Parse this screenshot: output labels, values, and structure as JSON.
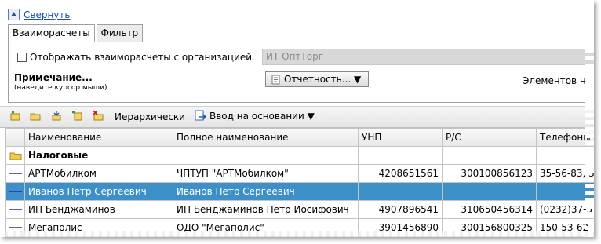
{
  "header": {
    "collapse_label": "Свернуть"
  },
  "tabs": [
    {
      "label": "Взаиморасчеты",
      "active": true
    },
    {
      "label": "Фильтр",
      "active": false
    }
  ],
  "settlements": {
    "show_label": "Отображать взаиморасчеты с организацией",
    "show_checked": false,
    "org_value": "ИТ ОптТорг"
  },
  "note": {
    "title": "Примечание...",
    "hint": "(наведите курсор мыши)"
  },
  "report_button": {
    "label": "Отчетность... ▼"
  },
  "elements_label": "Элементов н",
  "toolbar": {
    "hierarchy_label": "Иерархически",
    "input_basis_label": "Ввод на основании ▼"
  },
  "table": {
    "columns": [
      "",
      "Наименование",
      "Полное наименование",
      "УНП",
      "Р/С",
      "Телефоны"
    ],
    "rows": [
      {
        "type": "group",
        "icon": "folder-icon",
        "name": "Налоговые",
        "full_name": "",
        "unp": "",
        "account": "",
        "phone": ""
      },
      {
        "type": "item",
        "icon": "element-icon",
        "name": "АРТМобилком",
        "full_name": "ЧПТУП \"АРТМобилком\"",
        "unp": "4208651561",
        "account": "300100856123",
        "phone": "35-56-83, 3"
      },
      {
        "type": "item",
        "icon": "element-icon",
        "name": "Иванов Петр Сергеевич",
        "full_name": "Иванов Петр Сергеевич",
        "unp": "",
        "account": "",
        "phone": "",
        "selected": true
      },
      {
        "type": "item",
        "icon": "element-icon",
        "name": "ИП Бенджаминов",
        "full_name": "ИП Бенджаминов Петр Иосифович",
        "unp": "4907896541",
        "account": "310650456314",
        "phone": "(0232)37-5"
      },
      {
        "type": "item",
        "icon": "element-icon",
        "name": "Мегаполис",
        "full_name": "ОДО \"Мегаполис\"",
        "unp": "3901456890",
        "account": "300156800325",
        "phone": "150-53-62"
      }
    ]
  },
  "colors": {
    "selection": "#3d8fc7",
    "link": "#1a4fa8",
    "element_dash": "#1c2fa8",
    "folder": "#f2c94c"
  }
}
